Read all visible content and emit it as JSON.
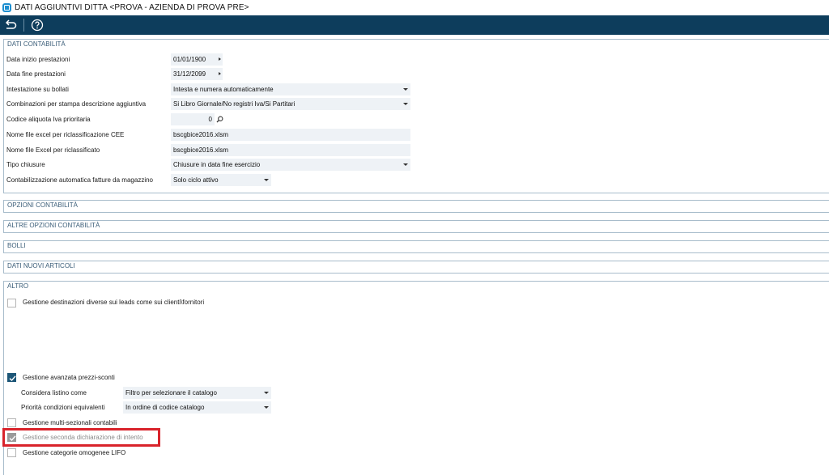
{
  "window": {
    "title": "DATI AGGIUNTIVI DITTA <PROVA - AZIENDA DI PROVA PRE>"
  },
  "toolbar": {
    "back_icon": "undo-arrow-icon",
    "help_icon": "help-circle-icon"
  },
  "sections": {
    "contabilita": {
      "header": "DATI CONTABILITÀ",
      "fields": {
        "data_inizio": {
          "label": "Data inizio prestazioni",
          "value": "01/01/1900"
        },
        "data_fine": {
          "label": "Data fine prestazioni",
          "value": "31/12/2099"
        },
        "intestazione": {
          "label": "Intestazione su bollati",
          "value": "Intesta e numera automaticamente"
        },
        "combinazioni": {
          "label": "Combinazioni per stampa descrizione aggiuntiva",
          "value": "Si Libro Giornale/No registri Iva/Si Partitari"
        },
        "codice_iva": {
          "label": "Codice aliquota Iva prioritaria",
          "value": "0"
        },
        "excel_cee": {
          "label": "Nome file excel per riclassificazione CEE",
          "value": "bscgbice2016.xlsm"
        },
        "excel_riclass": {
          "label": "Nome file Excel per riclassificato",
          "value": "bscgbice2016.xlsm"
        },
        "tipo_chiusure": {
          "label": "Tipo chiusure",
          "value": "Chiusure in data fine esercizio"
        },
        "contab_auto": {
          "label": "Contabilizzazione automatica fatture da magazzino",
          "value": "Solo ciclo attivo"
        }
      }
    },
    "opzioni": {
      "header": "OPZIONI CONTABILITÀ"
    },
    "altre_opzioni": {
      "header": "ALTRE OPZIONI CONTABILITÀ"
    },
    "bolli": {
      "header": "BOLLI"
    },
    "nuovi_articoli": {
      "header": "DATI NUOVI ARTICOLI"
    },
    "altro": {
      "header": "ALTRO",
      "destinazioni": {
        "label": "Gestione destinazioni diverse sui leads come sui clienti\\fornitori",
        "checked": false
      },
      "prezzi_sconti": {
        "label": "Gestione avanzata prezzi-sconti",
        "checked": true
      },
      "listino": {
        "label": "Considera listino come",
        "value": "Filtro per selezionare il catalogo"
      },
      "priorita": {
        "label": "Priorità condizioni equivalenti",
        "value": "In ordine di codice catalogo"
      },
      "multi_sezionali": {
        "label": "Gestione multi-sezionali contabili",
        "checked": false
      },
      "seconda_dichiarazione": {
        "label": "Gestione seconda dichiarazione di intento",
        "checked": true,
        "disabled": true
      },
      "lifo": {
        "label": "Gestione categorie omogenee LIFO",
        "checked": false
      }
    }
  },
  "colors": {
    "toolbar_bg": "#0d3d5c",
    "accent": "#1c5677",
    "highlight": "#d9232b",
    "field_bg": "#eef2f6"
  }
}
